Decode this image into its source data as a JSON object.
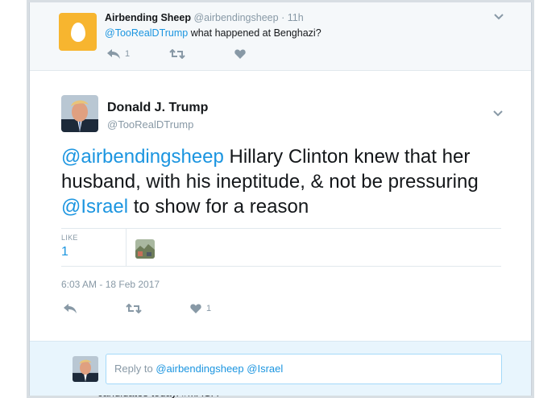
{
  "background": {
    "under_text": "candidates today. #MAGA"
  },
  "ancestor": {
    "name": "Airbending Sheep",
    "handle": "@airbendingsheep",
    "separator": "·",
    "time": "11h",
    "mention": "@TooRealDTrump",
    "text": " what happened at Benghazi?",
    "reply_count": "1",
    "avatar_color": "#f7b52f"
  },
  "tweet": {
    "name": "Donald J. Trump",
    "handle": "@TooRealDTrump",
    "text_parts": {
      "mention1": "@airbendingsheep",
      "body1": " Hillary Clinton knew that her husband, with his ineptitude, & not be pressuring ",
      "mention2": "@Israel",
      "body2": " to show for a reason"
    },
    "like_label": "LIKE",
    "like_count": "1",
    "timestamp": "6:03 AM - 18 Feb 2017",
    "action_like_count": "1"
  },
  "reply": {
    "prefix": "Reply to ",
    "mentions": "@airbendingsheep @Israel"
  },
  "colors": {
    "link": "#1b95e0",
    "muted": "#8899a6",
    "reply_bg": "#e8f5fd",
    "ancestor_bg": "#f5f8fa"
  }
}
